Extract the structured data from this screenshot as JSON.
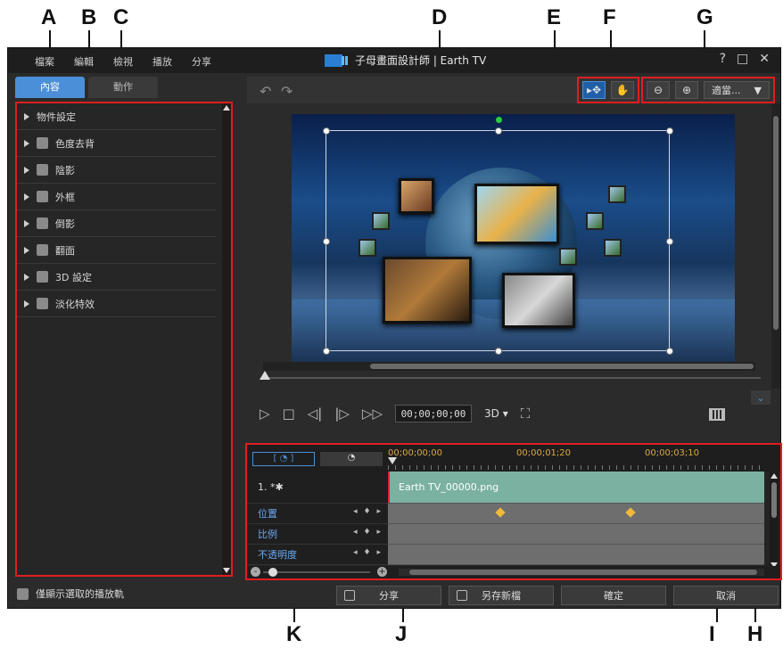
{
  "callouts": {
    "a": "A",
    "b": "B",
    "c": "C",
    "d": "D",
    "e": "E",
    "f": "F",
    "g": "G",
    "h": "H",
    "i": "I",
    "j": "J",
    "k": "K"
  },
  "app": {
    "title": "子母畫面設計師 | Earth TV",
    "menu": [
      "檔案",
      "編輯",
      "檢視",
      "播放",
      "分享"
    ],
    "window_controls": [
      "?",
      "□",
      "✕"
    ]
  },
  "left_panel": {
    "tabs": [
      "內容",
      "動作"
    ],
    "items": [
      {
        "label": "物件設定",
        "checkbox": false
      },
      {
        "label": "色度去背",
        "checkbox": true
      },
      {
        "label": "陰影",
        "checkbox": true
      },
      {
        "label": "外框",
        "checkbox": true
      },
      {
        "label": "倒影",
        "checkbox": true
      },
      {
        "label": "翻面",
        "checkbox": true
      },
      {
        "label": "3D 設定",
        "checkbox": true
      },
      {
        "label": "淡化特效",
        "checkbox": true
      }
    ],
    "show_selected_only": "僅顯示選取的播放軌"
  },
  "toolbar": {
    "undo_icon": "↶",
    "redo_icon": "↷",
    "select_icon": "▸✥",
    "hand_icon": "✋",
    "zoom_out_icon": "⊖",
    "zoom_in_icon": "⊕",
    "fit_label": "適當...",
    "fit_arrow": "▼"
  },
  "transport": {
    "play": "▷",
    "stop": "□",
    "prev_frame": "◁|",
    "next_frame": "|▷",
    "fast_forward": "▷▷",
    "timecode": "00;00;00;00",
    "mode_3d": "3D ▾",
    "fullscreen": "⛶",
    "expand": "⌄"
  },
  "timeline": {
    "tab_icons": [
      "[ ◔ ]",
      "◔"
    ],
    "ruler": [
      "00;00;00;00",
      "00;00;01;20",
      "00;00;03;10"
    ],
    "tracks": [
      {
        "label": "1. *✱",
        "clip": "Earth TV_00000.png"
      },
      {
        "label": "位置"
      },
      {
        "label": "比例"
      },
      {
        "label": "不透明度"
      }
    ],
    "kf_controls": "◂ ♦ ▸"
  },
  "buttons": {
    "share": "分享",
    "save_as": "另存新檔",
    "ok": "確定",
    "cancel": "取消"
  },
  "colors": {
    "highlight": "#e01e1e",
    "accent": "#4a8fd8",
    "keyframe": "#f0b93a",
    "clip": "#7ab1a0"
  }
}
